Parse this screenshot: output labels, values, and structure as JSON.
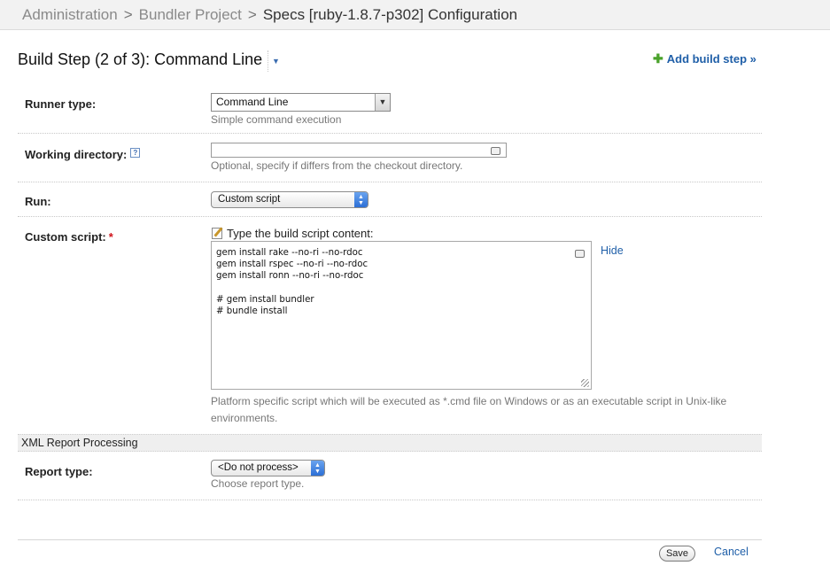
{
  "breadcrumb": {
    "items": [
      "Administration",
      "Bundler Project",
      "Specs [ruby-1.8.7-p302] Configuration"
    ],
    "separator": ">"
  },
  "header": {
    "title": "Build Step (2 of 3): Command Line",
    "add_step_label": "Add build step »"
  },
  "runner_type": {
    "label": "Runner type:",
    "value": "Command Line",
    "note": "Simple command execution"
  },
  "working_directory": {
    "label": "Working directory:",
    "value": "",
    "note": "Optional, specify if differs from the checkout directory."
  },
  "run": {
    "label": "Run:",
    "value": "Custom script"
  },
  "custom_script": {
    "label": "Custom script:",
    "required_mark": "*",
    "header": "Type the build script content:",
    "content": "gem install rake --no-ri --no-rdoc\ngem install rspec --no-ri --no-rdoc\ngem install ronn --no-ri --no-rdoc\n\n# gem install bundler\n# bundle install",
    "hide_label": "Hide",
    "note": "Platform specific script which will be executed as *.cmd file on Windows or as an executable script in Unix-like environments."
  },
  "xml_report": {
    "section_title": "XML Report Processing",
    "label": "Report type:",
    "value": "<Do not process>",
    "note": "Choose report type."
  },
  "footer": {
    "save_label": "Save",
    "cancel_label": "Cancel"
  },
  "colors": {
    "link": "#1f5fa8",
    "required": "#d0121a",
    "add_icon": "#4aa22b"
  }
}
